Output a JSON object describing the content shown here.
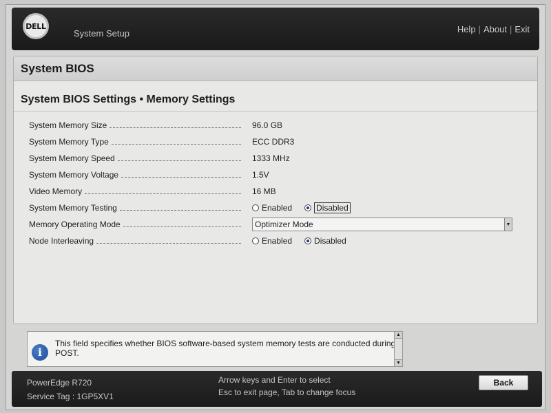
{
  "header": {
    "logo_text": "DELL",
    "app_title": "System Setup",
    "links": [
      "Help",
      "About",
      "Exit"
    ]
  },
  "panel": {
    "title": "System BIOS",
    "subtitle": "System BIOS Settings • Memory Settings"
  },
  "settings": [
    {
      "label": "System Memory Size",
      "value": "96.0 GB"
    },
    {
      "label": "System Memory Type",
      "value": "ECC DDR3"
    },
    {
      "label": "System Memory Speed",
      "value": "1333 MHz"
    },
    {
      "label": "System Memory Voltage",
      "value": "1.5V"
    },
    {
      "label": "Video Memory",
      "value": "16 MB"
    },
    {
      "label": "System Memory Testing",
      "options": [
        "Enabled",
        "Disabled"
      ],
      "selected": "Disabled"
    },
    {
      "label": "Memory Operating Mode",
      "value": "Optimizer Mode"
    },
    {
      "label": "Node Interleaving",
      "options": [
        "Enabled",
        "Disabled"
      ],
      "selected": "Disabled"
    }
  ],
  "help": {
    "text": "This field specifies whether BIOS software-based system memory tests are conducted during POST."
  },
  "footer": {
    "model": "PowerEdge R720",
    "service_tag": "Service Tag : 1GP5XV1",
    "hint_line1": "Arrow keys and Enter to select",
    "hint_line2": "Esc to exit page, Tab to change focus",
    "back_label": "Back"
  },
  "colors": {
    "header_bg": "#1f1f1f",
    "panel_bg": "#e8e8e6",
    "radio_selected": "#1b3d8a",
    "info_icon": "#1d4c99"
  }
}
